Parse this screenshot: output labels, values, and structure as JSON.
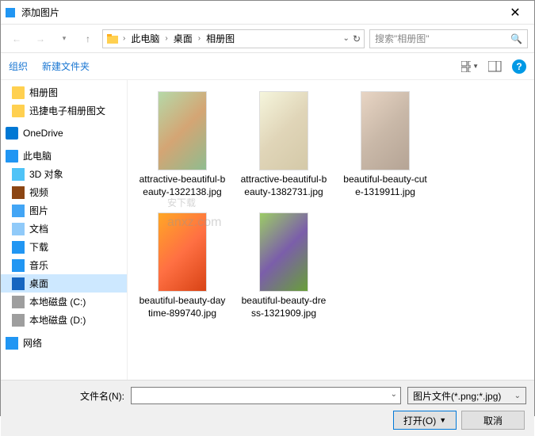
{
  "title": "添加图片",
  "breadcrumb": {
    "root": "此电脑",
    "seg2": "桌面",
    "seg3": "相册图"
  },
  "search": {
    "placeholder": "搜索\"相册图\""
  },
  "toolbar": {
    "organize": "组织",
    "newfolder": "新建文件夹",
    "help": "?"
  },
  "sidebar": {
    "items": [
      {
        "label": "相册图",
        "cls": "folder-ic",
        "indent": ""
      },
      {
        "label": "迅捷电子相册图文",
        "cls": "folder-ic",
        "indent": ""
      },
      {
        "label": "OneDrive",
        "cls": "onedrive-ic",
        "indent": "l1"
      },
      {
        "label": "此电脑",
        "cls": "pc-ic",
        "indent": "l1"
      },
      {
        "label": "3D 对象",
        "cls": "obj3d-ic",
        "indent": ""
      },
      {
        "label": "视频",
        "cls": "video-ic",
        "indent": ""
      },
      {
        "label": "图片",
        "cls": "pic-ic",
        "indent": ""
      },
      {
        "label": "文档",
        "cls": "doc-ic",
        "indent": ""
      },
      {
        "label": "下载",
        "cls": "dl-ic",
        "indent": ""
      },
      {
        "label": "音乐",
        "cls": "music-ic",
        "indent": ""
      },
      {
        "label": "桌面",
        "cls": "desk-ic",
        "indent": "",
        "selected": true
      },
      {
        "label": "本地磁盘 (C:)",
        "cls": "disk-ic",
        "indent": ""
      },
      {
        "label": "本地磁盘 (D:)",
        "cls": "disk-ic",
        "indent": ""
      },
      {
        "label": "网络",
        "cls": "net-ic",
        "indent": "l1"
      }
    ]
  },
  "files": [
    {
      "label": "attractive-beautiful-beauty-1322138.jpg",
      "cls": "i1"
    },
    {
      "label": "attractive-beautiful-beauty-1382731.jpg",
      "cls": "i2"
    },
    {
      "label": "beautiful-beauty-cute-1319911.jpg",
      "cls": "i3"
    },
    {
      "label": "beautiful-beauty-daytime-899740.jpg",
      "cls": "i4"
    },
    {
      "label": "beautiful-beauty-dress-1321909.jpg",
      "cls": "i5"
    }
  ],
  "watermark": {
    "big": "安下载",
    "small": "anxz.com"
  },
  "footer": {
    "filename_label": "文件名(N):",
    "filter": "图片文件(*.png;*.jpg)",
    "open": "打开(O)",
    "cancel": "取消"
  }
}
